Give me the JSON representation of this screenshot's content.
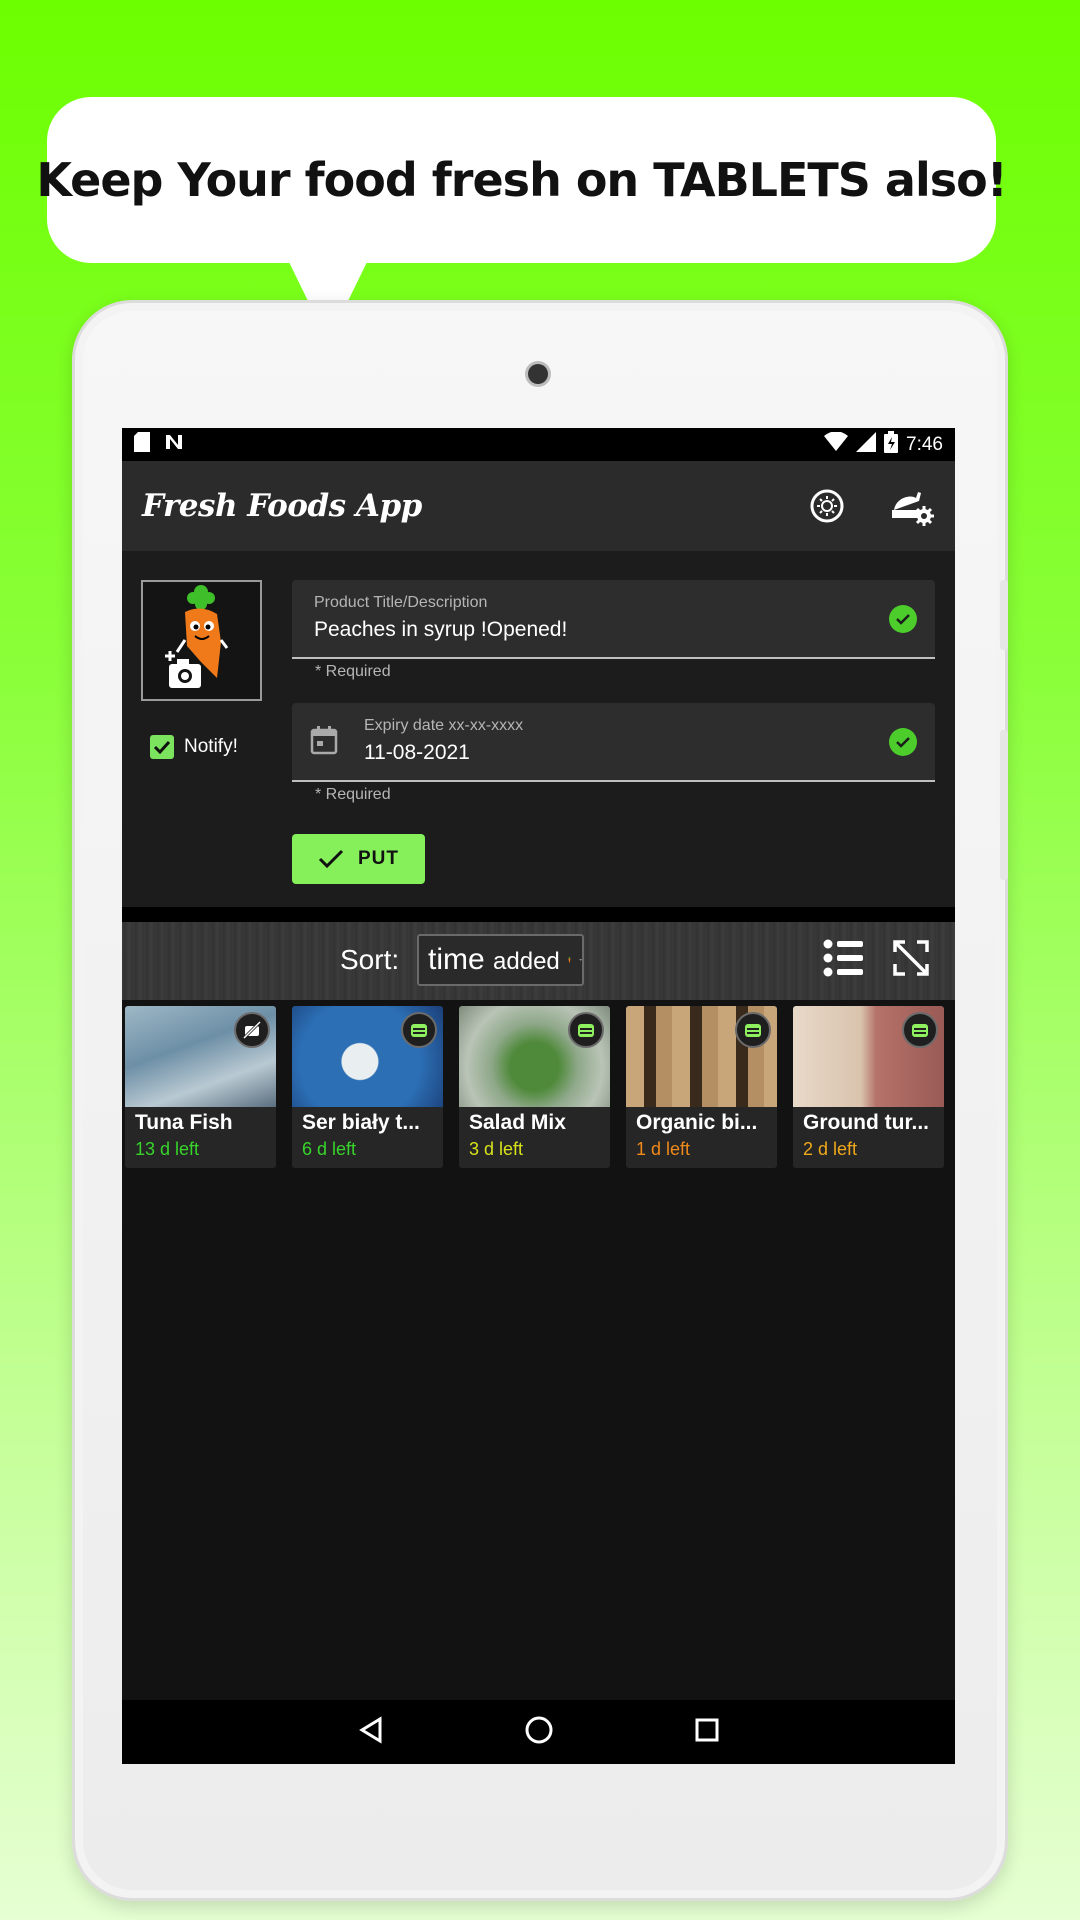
{
  "promo": {
    "headline": "Keep Your food fresh on TABLETS also!"
  },
  "statusbar": {
    "time": "7:46"
  },
  "appbar": {
    "title": "Fresh Foods App",
    "theme_icon": "brightness-icon",
    "settings_icon": "food-settings-icon"
  },
  "form": {
    "notify_label": "Notify!",
    "notify_checked": true,
    "title_field": {
      "label": "Product Title/Description",
      "value": "Peaches in syrup !Opened!",
      "helper": "* Required"
    },
    "date_field": {
      "label": "Expiry date xx-xx-xxxx",
      "value": "11-08-2021",
      "helper": "* Required"
    },
    "put_label": "PUT"
  },
  "sort": {
    "label": "Sort:",
    "value_main": "time",
    "value_sub": "added"
  },
  "items": [
    {
      "name": "Tuna Fish",
      "left": "13 d left",
      "color": "#37d42a",
      "badge": "no-food-icon"
    },
    {
      "name": "Ser biały t...",
      "left": "6 d left",
      "color": "#37d42a",
      "badge": "container-icon"
    },
    {
      "name": "Salad Mix",
      "left": "3 d left",
      "color": "#d8e21a",
      "badge": "container-icon"
    },
    {
      "name": "Organic bi...",
      "left": "1 d left",
      "color": "#f08a1a",
      "badge": "container-icon"
    },
    {
      "name": "Ground tur...",
      "left": "2 d left",
      "color": "#f0a81a",
      "badge": "container-icon"
    }
  ]
}
